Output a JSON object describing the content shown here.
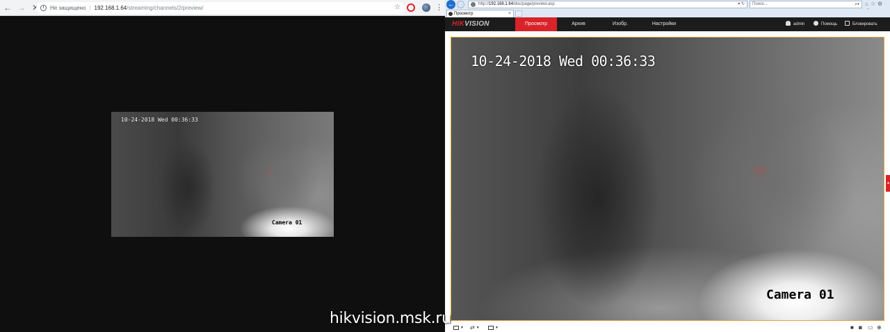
{
  "left_browser": {
    "security_label": "Не защищено",
    "url_host": "192.168.1.64",
    "url_path": "/streaming/channels/2/preview/",
    "video": {
      "osd_datetime": "10-24-2018 Wed 00:36:33",
      "osd_camera": "Camera 01"
    }
  },
  "right_browser": {
    "url_prefix": "http://",
    "url_host": "192.168.1.64",
    "url_path": "/doc/page/preview.asp",
    "search_placeholder": "Поиск...",
    "tab_title": "Просмотр",
    "app": {
      "logo_red": "HIK",
      "logo_rest": "VISION",
      "menu": [
        {
          "label": "Просмотр",
          "active": true
        },
        {
          "label": "Архив",
          "active": false
        },
        {
          "label": "Изобр.",
          "active": false
        },
        {
          "label": "Настройки",
          "active": false
        }
      ],
      "user": "admin",
      "help": "Помощь",
      "logout": "Блокировать"
    },
    "video": {
      "osd_datetime": "10-24-2018 Wed 00:36:33",
      "osd_camera": "Camera 01"
    }
  },
  "watermark": "hikvision.msk.ru",
  "colors": {
    "accent_red": "#d9232a",
    "nav_bg": "#1c1c1c",
    "video_border": "#e3a63a"
  }
}
